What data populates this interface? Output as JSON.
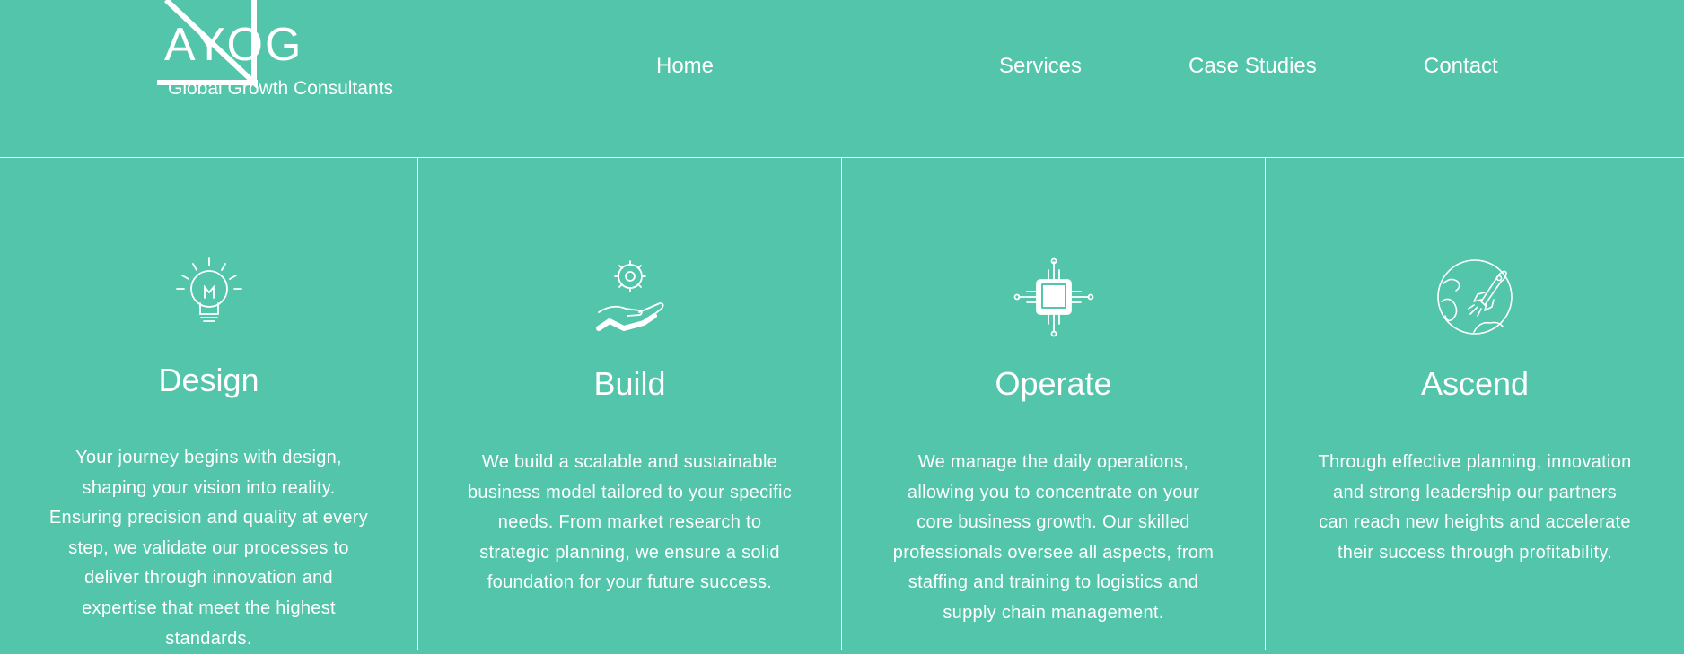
{
  "brand": {
    "name": "AYOG",
    "tagline": "Global Growth Consultants"
  },
  "nav": {
    "items": [
      {
        "label": "Home"
      },
      {
        "label": "Services"
      },
      {
        "label": "Case Studies"
      },
      {
        "label": "Contact"
      }
    ]
  },
  "colors": {
    "background": "#52c5aa",
    "text": "#ffffff"
  },
  "columns": [
    {
      "icon": "lightbulb-icon",
      "title": "Design",
      "description": "Your journey begins with design, shaping your vision into reality. Ensuring precision and quality at every step, we validate our processes to deliver through innovation and expertise that meet the highest standards."
    },
    {
      "icon": "hand-gear-icon",
      "title": "Build",
      "description": "We build a scalable and sustainable business model tailored to your specific needs. From market research to strategic planning, we ensure a solid foundation for your future success."
    },
    {
      "icon": "microchip-icon",
      "title": "Operate",
      "description": "We manage the daily operations, allowing you to concentrate on your core business growth. Our skilled professionals oversee all aspects, from staffing and training to logistics and supply chain management."
    },
    {
      "icon": "rocket-globe-icon",
      "title": "Ascend",
      "description": "Through effective planning, innovation and strong leadership our partners can reach new heights and accelerate their success through profitability."
    }
  ]
}
